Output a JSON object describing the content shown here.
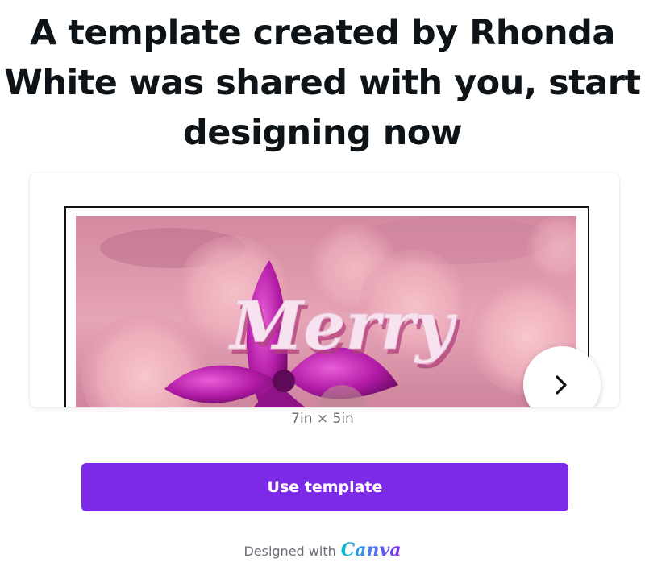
{
  "header": {
    "title": "A template created by Rhonda White was shared with you, start designing now"
  },
  "preview": {
    "artwork_text": "Merry",
    "dimensions": "7in × 5in",
    "next_icon": "chevron-right-icon"
  },
  "actions": {
    "use_template_label": "Use template"
  },
  "footer": {
    "designed_with": "Designed with",
    "brand": "Canva"
  },
  "colors": {
    "accent": "#7d2ae8",
    "title_text": "#0e1318",
    "muted_text": "#6b6f76"
  }
}
